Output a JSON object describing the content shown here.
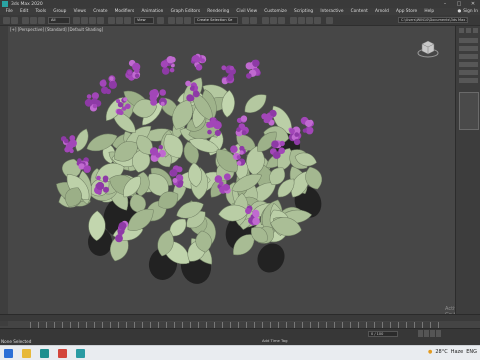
{
  "window": {
    "title": "3ds Max 2020",
    "controls": [
      "–",
      "□",
      "✕"
    ]
  },
  "menu": [
    "File",
    "Edit",
    "Tools",
    "Group",
    "Views",
    "Create",
    "Modifiers",
    "Animation",
    "Graph Editors",
    "Rendering",
    "Civil View",
    "Customize",
    "Scripting",
    "Interactive",
    "Content",
    "Arnold",
    "App Store",
    "Help"
  ],
  "signin": {
    "label": "Sign In"
  },
  "toolbar": {
    "select_filter": "All",
    "view_dropdown": "View",
    "selection_set": "Create Selection Se",
    "workspace_path": "C:\\Users\\WIN10\\Documents\\3ds Max 2020"
  },
  "viewport": {
    "label": "[+] [Perspective] [Standard] [Default Shading]"
  },
  "watermark": {
    "line1": "Activate W",
    "line2": "Go to Setti"
  },
  "status": {
    "selection": "None Selected",
    "add_time_tag": "Add Time Tag",
    "frame": "0 / 100"
  },
  "taskbar": {
    "weather": "28°C",
    "weather_desc": "Haze",
    "time": "ENG"
  },
  "colors": {
    "flower": "#9a3fb0",
    "leaf": "#b8c9a6",
    "viewport_bg": "#474747",
    "accent": "#2aa3a3"
  },
  "icons": [
    "windows-start-icon",
    "explorer-icon",
    "max-icon",
    "chrome-icon",
    "settings-icon"
  ]
}
